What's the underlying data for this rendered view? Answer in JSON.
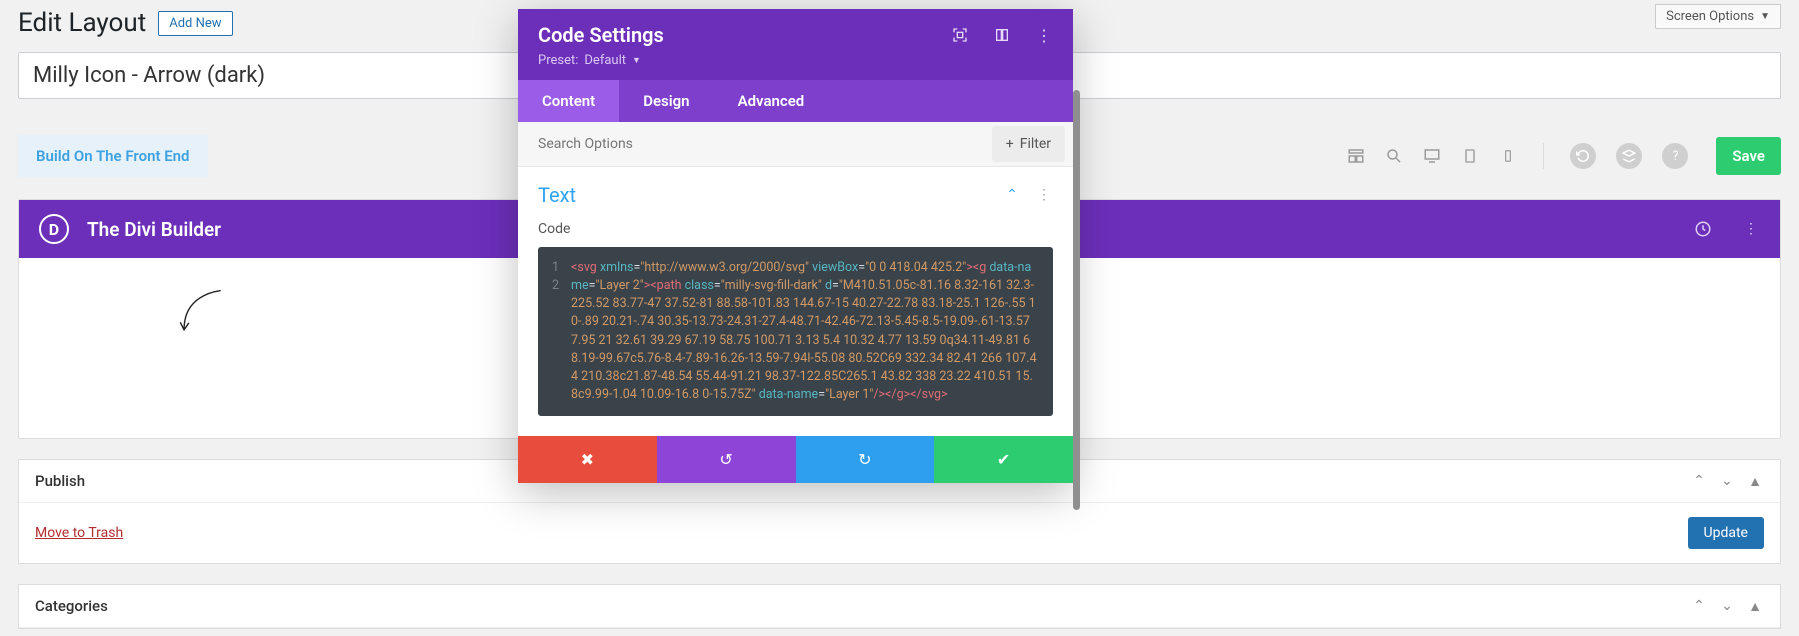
{
  "screen_options_label": "Screen Options",
  "page_title": "Edit Layout",
  "add_new_label": "Add New",
  "title_input_value": "Milly Icon - Arrow (dark)",
  "front_end_label": "Build On The Front End",
  "save_label": "Save",
  "divi_builder_title": "The Divi Builder",
  "publish": {
    "heading": "Publish",
    "trash_label": "Move to Trash",
    "update_label": "Update"
  },
  "categories_heading": "Categories",
  "modal": {
    "title": "Code Settings",
    "preset_label": "Preset:",
    "preset_value": "Default",
    "tabs": [
      "Content",
      "Design",
      "Advanced"
    ],
    "active_tab": 0,
    "search_placeholder": "Search Options",
    "filter_label": "Filter",
    "section_title": "Text",
    "code_label": "Code",
    "gutter": [
      "1",
      "2"
    ],
    "code_tokens": [
      {
        "t": "tag",
        "v": "<svg"
      },
      {
        "t": "p",
        "v": " "
      },
      {
        "t": "attr",
        "v": "xmlns"
      },
      {
        "t": "p",
        "v": "="
      },
      {
        "t": "str",
        "v": "\"http://www.w3.org/2000/svg\""
      },
      {
        "t": "p",
        "v": " "
      },
      {
        "t": "attr",
        "v": "viewBox"
      },
      {
        "t": "p",
        "v": "="
      },
      {
        "t": "str",
        "v": "\"0 0 418.04 425.2\""
      },
      {
        "t": "tag",
        "v": "><g"
      },
      {
        "t": "p",
        "v": " "
      },
      {
        "t": "attr",
        "v": "data-name"
      },
      {
        "t": "p",
        "v": "="
      },
      {
        "t": "str",
        "v": "\"Layer 2\""
      },
      {
        "t": "tag",
        "v": "><path"
      },
      {
        "t": "p",
        "v": " "
      },
      {
        "t": "attr",
        "v": "class"
      },
      {
        "t": "p",
        "v": "="
      },
      {
        "t": "str",
        "v": "\"milly-svg-fill-dark\""
      },
      {
        "t": "p",
        "v": " "
      },
      {
        "t": "attr",
        "v": "d"
      },
      {
        "t": "p",
        "v": "="
      },
      {
        "t": "str",
        "v": "\"M410.51.05c-81.16 8.32-161 32.3-225.52 83.77-47 37.52-81 88.58-101.83 144.67-15 40.27-22.78 83.18-25.1 126-.55 10-.89 20.21-.74 30.35-13.73-24.31-27.4-48.71-42.46-72.13-5.45-8.5-19.09-.61-13.57 7.95 21 32.61 39.29 67.19 58.75 100.71 3.13 5.4 10.32 4.77 13.59 0q34.11-49.81 68.19-99.67c5.76-8.4-7.89-16.26-13.59-7.94l-55.08 80.52C69 332.34 82.41 266 107.44 210.38c21.87-48.54 55.44-91.21 98.37-122.85C265.1 43.82 338 23.22 410.51 15.8c9.99-1.04 10.09-16.8 0-15.75Z\""
      },
      {
        "t": "p",
        "v": " "
      },
      {
        "t": "attr",
        "v": "data-name"
      },
      {
        "t": "p",
        "v": "="
      },
      {
        "t": "str",
        "v": "\"Layer 1\""
      },
      {
        "t": "tag",
        "v": "/></g></svg>"
      }
    ]
  },
  "colors": {
    "purple": "#6c2fb9",
    "purple_light": "#9b5de7",
    "blue_link": "#2ea3f2",
    "green": "#2ecc71"
  }
}
